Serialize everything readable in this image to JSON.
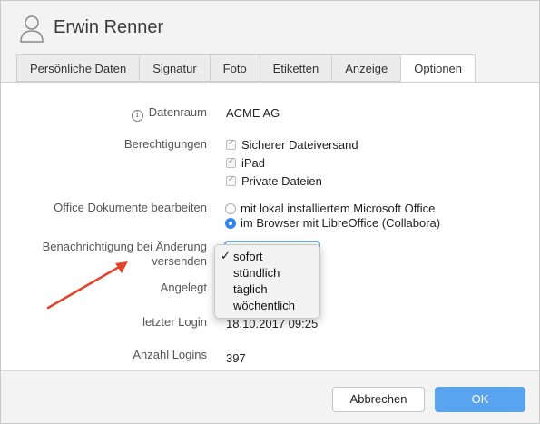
{
  "header": {
    "user_name": "Erwin Renner"
  },
  "tabs": [
    {
      "label": "Persönliche Daten"
    },
    {
      "label": "Signatur"
    },
    {
      "label": "Foto"
    },
    {
      "label": "Etiketten"
    },
    {
      "label": "Anzeige"
    },
    {
      "label": "Optionen",
      "active": true
    }
  ],
  "fields": {
    "datenraum": {
      "label": "Datenraum",
      "value": "ACME AG"
    },
    "berechtigungen": {
      "label": "Berechtigungen",
      "items": [
        {
          "label": "Sicherer Dateiversand",
          "checked": true
        },
        {
          "label": "iPad",
          "checked": true
        },
        {
          "label": "Private Dateien",
          "checked": true
        }
      ]
    },
    "office": {
      "label": "Office Dokumente bearbeiten",
      "options": [
        {
          "label": "mit lokal installiertem Microsoft Office",
          "selected": false
        },
        {
          "label": "im Browser mit LibreOffice (Collabora)",
          "selected": true
        }
      ]
    },
    "benachrichtigung": {
      "label_line1": "Benachrichtigung bei Änderung",
      "label_line2": "versenden",
      "options": [
        "sofort",
        "stündlich",
        "täglich",
        "wöchentlich"
      ],
      "selected": "sofort"
    },
    "angelegt": {
      "label": "Angelegt"
    },
    "letzter_login": {
      "label": "letzter Login",
      "value": "18.10.2017 09:25"
    },
    "anzahl_logins": {
      "label": "Anzahl Logins",
      "value": "397"
    }
  },
  "footer": {
    "cancel_label": "Abbrechen",
    "ok_label": "OK"
  },
  "colors": {
    "accent": "#2e86f0",
    "ok_button": "#5aa3ef",
    "annotation_arrow": "#e0442b"
  },
  "icons": {
    "avatar": "user-silhouette-icon",
    "info": "info-circle-icon",
    "check": "checkmark-icon"
  }
}
